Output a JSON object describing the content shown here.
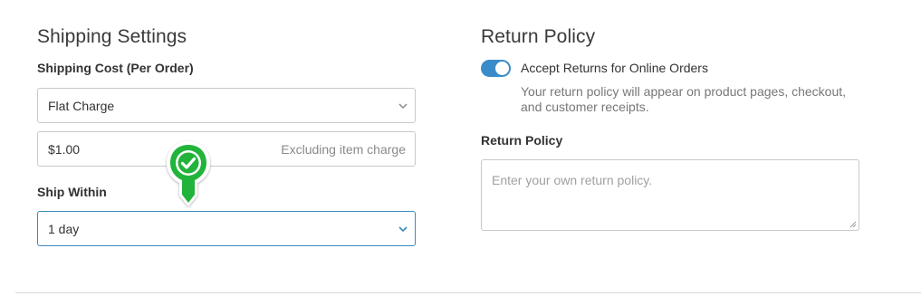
{
  "shipping": {
    "title": "Shipping Settings",
    "cost_label": "Shipping Cost (Per Order)",
    "cost_type": "Flat Charge",
    "amount_value": "$1.00",
    "amount_suffix": "Excluding item charge",
    "ship_within_label": "Ship Within",
    "ship_within_value": "1 day"
  },
  "returns": {
    "title": "Return Policy",
    "toggle_label": "Accept Returns for Online Orders",
    "toggle_on": true,
    "help_text": "Your return policy will appear on product pages, checkout, and customer receipts.",
    "policy_label": "Return Policy",
    "policy_placeholder": "Enter your own return policy."
  },
  "icons": {
    "chevron": "chevron-down-icon",
    "marker": "check-marker-icon",
    "resize": "resize-grip-icon"
  },
  "colors": {
    "accent": "#3a8bc9",
    "focus_border": "#3a8bbd",
    "marker_green": "#22b33a"
  }
}
